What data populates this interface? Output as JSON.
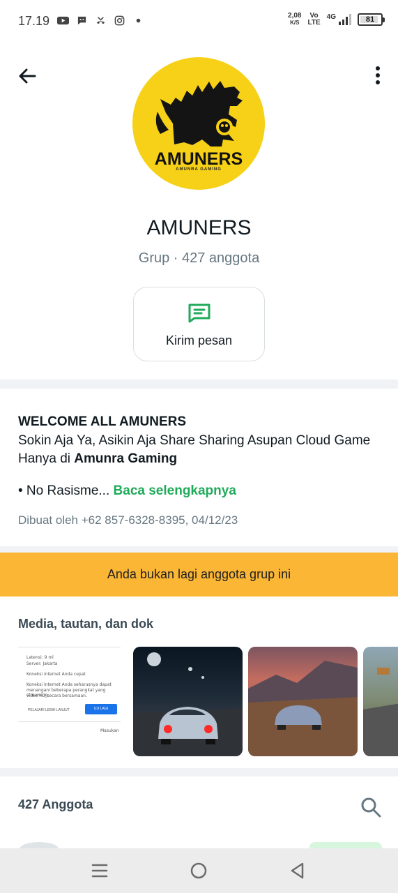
{
  "status_bar": {
    "time": "17.19",
    "net_speed_value": "2,08",
    "net_speed_unit": "K/S",
    "volte_top": "Vo",
    "volte_bottom": "LTE",
    "network": "4G",
    "battery": "81",
    "notification_icons": [
      "youtube-icon",
      "chat-icon",
      "missed-call-icon",
      "instagram-icon",
      "dot-icon"
    ]
  },
  "header": {
    "back_icon": "arrow-back-icon",
    "menu_icon": "more-vertical-icon"
  },
  "group": {
    "avatar_logo_text": "AMUNERS",
    "avatar_logo_subtext": "AMUNRA GAMING",
    "name": "AMUNERS",
    "meta": "Grup · 427 anggota"
  },
  "actions": {
    "message_label": "Kirim pesan",
    "message_icon": "message-icon"
  },
  "description": {
    "title": "WELCOME ALL AMUNERS",
    "body_prefix": "Sokin Aja Ya, Asikin Aja Share Sharing Asupan Cloud Game Hanya di ",
    "body_bold": "Amunra Gaming",
    "rule": "• No Rasisme...",
    "read_more": "Baca selengkapnya",
    "created_by": "Dibuat oleh +62 857-6328-8395, 04/12/23"
  },
  "banner": {
    "text": "Anda bukan lagi anggota grup ini",
    "color": "#fbb635"
  },
  "media": {
    "heading": "Media, tautan, dan dok",
    "doc_preview": {
      "latency": "Latensi: 9 ml",
      "server": "Server: Jakarta",
      "status": "Koneksi internet Anda cepat",
      "note_1": "Koneksi internet Anda seharusnya dapat",
      "note_2": "menangani beberapa perangkat yang streaming",
      "note_3": "video HD secara bersamaan.",
      "learn_more": "PELAJARI LEBIH LANJUT",
      "retry": "UJI LAGI",
      "footer": "Masukan"
    }
  },
  "members": {
    "count_label": "427 Anggota",
    "search_icon": "search-icon"
  },
  "nav_bar": {
    "recents_icon": "recents-icon",
    "home_icon": "home-icon",
    "back_icon": "nav-back-icon"
  },
  "colors": {
    "accent_green": "#1faa59",
    "text_primary": "#111b21",
    "text_secondary": "#667781"
  }
}
